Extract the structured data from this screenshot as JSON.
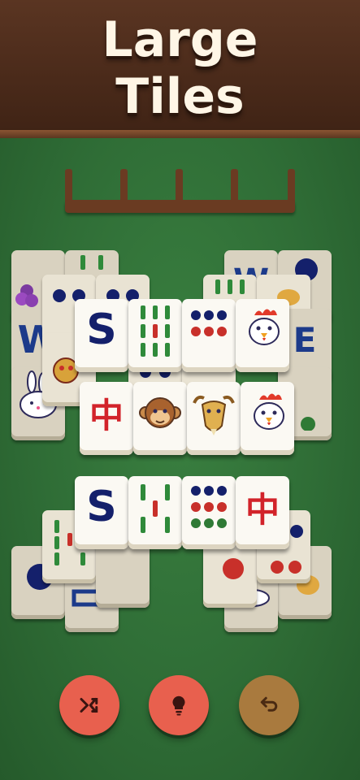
{
  "header": {
    "title_line1": "Large",
    "title_line2": "Tiles"
  },
  "tiles": {
    "s_letter": "S",
    "zhong": "中"
  },
  "buttons": {
    "shuffle": {
      "icon": "shuffle-icon",
      "color": "#e8604e"
    },
    "hint": {
      "icon": "lightbulb-icon",
      "color": "#e8604e"
    },
    "undo": {
      "icon": "undo-icon",
      "color": "#a97a3e"
    }
  },
  "colors": {
    "felt": "#2f6b35",
    "wood": "#4a2a1a",
    "tile": "#fbf9f3"
  }
}
